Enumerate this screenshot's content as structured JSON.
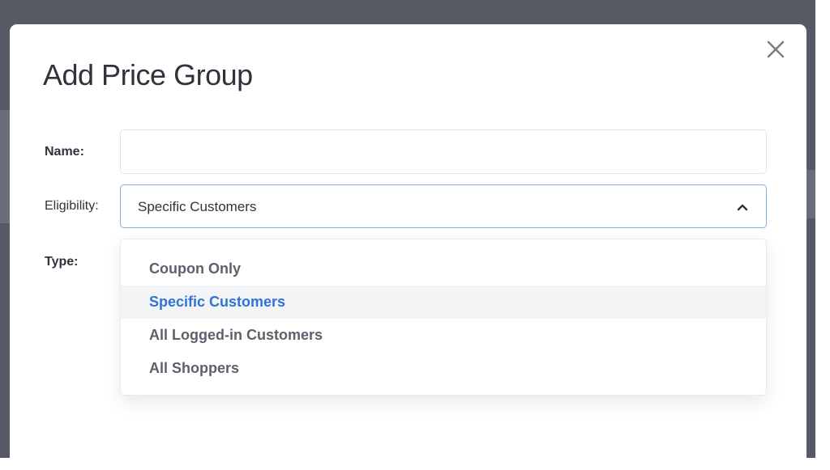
{
  "modal": {
    "title": "Add Price Group",
    "close_icon": "close-icon"
  },
  "form": {
    "name_label": "Name:",
    "name_value": "",
    "eligibility_label": "Eligibility:",
    "eligibility_value": "Specific Customers",
    "type_label": "Type:"
  },
  "dropdown": {
    "options": [
      {
        "label": "Coupon Only",
        "selected": false
      },
      {
        "label": "Specific Customers",
        "selected": true
      },
      {
        "label": "All Logged-in Customers",
        "selected": false
      },
      {
        "label": "All Shoppers",
        "selected": false
      }
    ]
  },
  "colors": {
    "backdrop": "#565a64",
    "accent": "#2f73d6",
    "focus_border": "#86aede",
    "text": "#30333b",
    "option_text": "#5c616b"
  }
}
